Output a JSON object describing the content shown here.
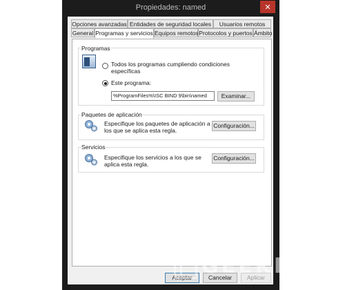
{
  "window": {
    "title": "Propiedades: named",
    "close_glyph": "✕"
  },
  "tabs": {
    "row1": [
      "Opciones avanzadas",
      "Entidades de seguridad locales",
      "Usuarios remotos"
    ],
    "row2": [
      "General",
      "Programas y servicios",
      "Equipos remotos",
      "Protocolos y puertos",
      "Ámbito"
    ],
    "active": "Programas y servicios"
  },
  "programas": {
    "title": "Programas",
    "icon": "program-window-icon",
    "option_all_line1": "Todos los programas cumpliendo condiciones",
    "option_all_line2": "específicas",
    "option_this": "Este programa:",
    "path_value": "%ProgramFiles%\\ISC BIND 9\\bin\\named",
    "browse_label": "Examinar..."
  },
  "paquetes": {
    "title": "Paquetes de aplicación",
    "icon": "gears-icon",
    "desc_line1": "Especifique los paquetes de aplicación a",
    "desc_line2": "los que se aplica esta regla.",
    "config_label": "Configuración..."
  },
  "servicios": {
    "title": "Servicios",
    "icon": "gears-icon",
    "desc_line1": "Especifique los servicios a los que se",
    "desc_line2": "aplica esta regla.",
    "config_label": "Configuración..."
  },
  "footer": {
    "accept": "Aceptar",
    "cancel": "Cancelar",
    "apply": "Aplicar"
  },
  "watermark": {
    "text": "GEEKNETIC"
  },
  "colors": {
    "titlebar": "#1c1c1c",
    "close": "#b8342a",
    "dialog": "#f0f0f0",
    "focus_border": "#3c7fb1"
  }
}
